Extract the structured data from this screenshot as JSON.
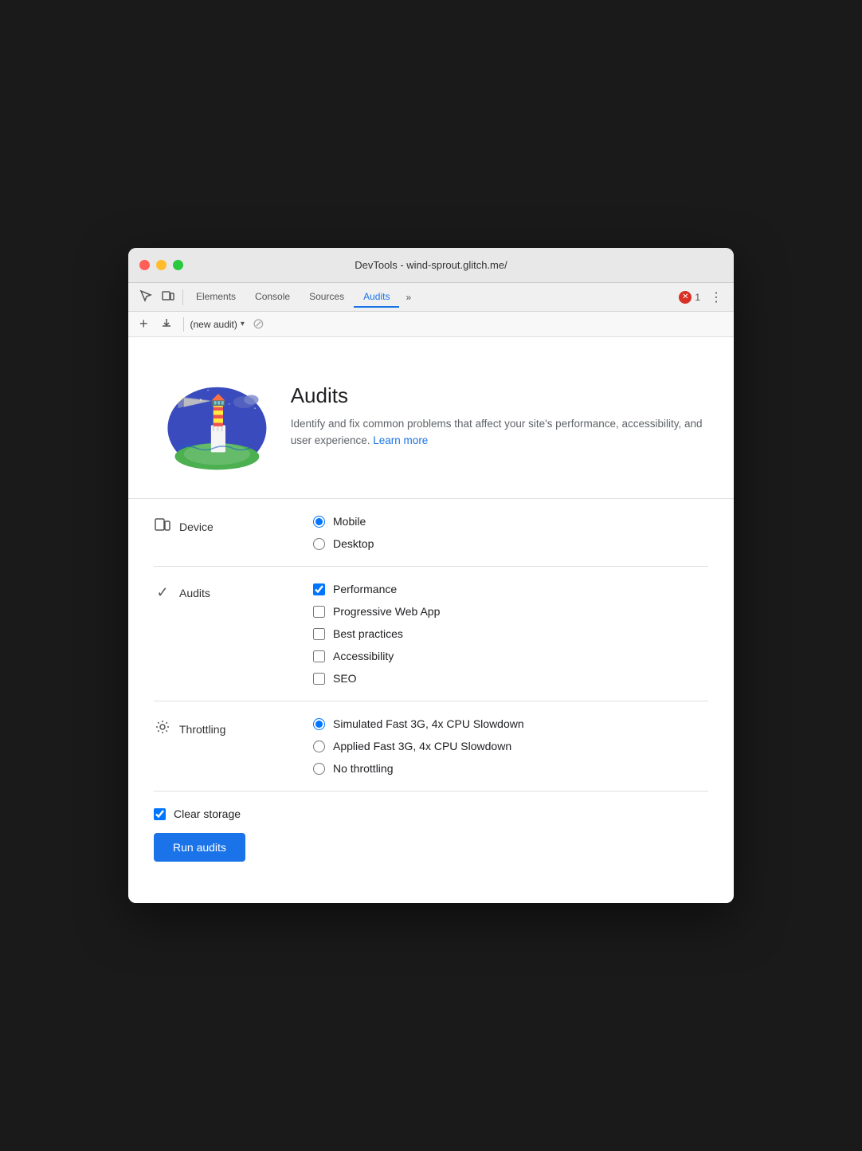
{
  "window": {
    "title": "DevTools - wind-sprout.glitch.me/"
  },
  "tabs": {
    "items": [
      {
        "id": "elements",
        "label": "Elements",
        "active": false
      },
      {
        "id": "console",
        "label": "Console",
        "active": false
      },
      {
        "id": "sources",
        "label": "Sources",
        "active": false
      },
      {
        "id": "audits",
        "label": "Audits",
        "active": true
      },
      {
        "id": "more",
        "label": "»",
        "active": false
      }
    ],
    "error_count": "1"
  },
  "subtoolbar": {
    "new_audit_placeholder": "(new audit)"
  },
  "hero": {
    "title": "Audits",
    "description": "Identify and fix common problems that affect your site's performance, accessibility, and user experience.",
    "learn_more": "Learn more"
  },
  "device": {
    "label": "Device",
    "options": [
      {
        "id": "mobile",
        "label": "Mobile",
        "checked": true
      },
      {
        "id": "desktop",
        "label": "Desktop",
        "checked": false
      }
    ]
  },
  "audits_section": {
    "label": "Audits",
    "options": [
      {
        "id": "performance",
        "label": "Performance",
        "checked": true
      },
      {
        "id": "pwa",
        "label": "Progressive Web App",
        "checked": false
      },
      {
        "id": "best-practices",
        "label": "Best practices",
        "checked": false
      },
      {
        "id": "accessibility",
        "label": "Accessibility",
        "checked": false
      },
      {
        "id": "seo",
        "label": "SEO",
        "checked": false
      }
    ]
  },
  "throttling": {
    "label": "Throttling",
    "options": [
      {
        "id": "simulated",
        "label": "Simulated Fast 3G, 4x CPU Slowdown",
        "checked": true
      },
      {
        "id": "applied",
        "label": "Applied Fast 3G, 4x CPU Slowdown",
        "checked": false
      },
      {
        "id": "none",
        "label": "No throttling",
        "checked": false
      }
    ]
  },
  "bottom": {
    "clear_storage_label": "Clear storage",
    "clear_storage_checked": true,
    "run_button": "Run audits"
  }
}
